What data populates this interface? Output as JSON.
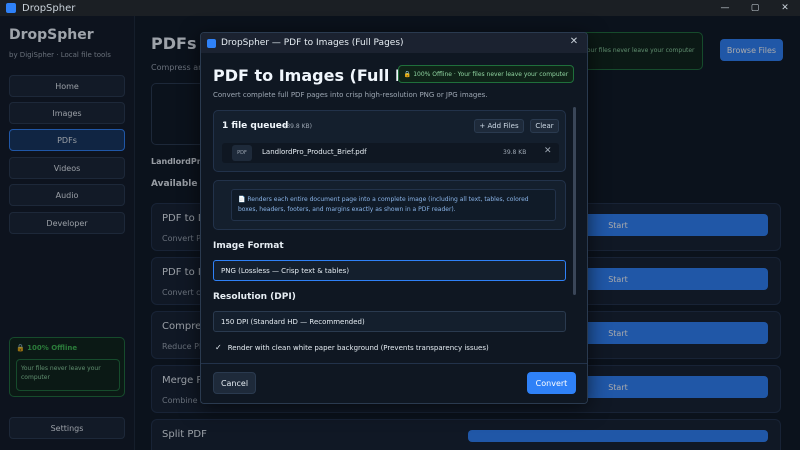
{
  "window": {
    "title": "DropSpher",
    "minimize": "—",
    "maximize": "▢",
    "close": "✕"
  },
  "sidebar": {
    "brand": "DropSpher",
    "brand_sub": "by DigiSpher · Local file tools",
    "items": [
      {
        "label": "Home"
      },
      {
        "label": "Images"
      },
      {
        "label": "PDFs"
      },
      {
        "label": "Videos"
      },
      {
        "label": "Audio"
      },
      {
        "label": "Developer"
      }
    ],
    "offline_title": "🔒 100% Offline",
    "offline_body": "Your files never leave your computer",
    "settings": "Settings"
  },
  "main": {
    "title": "PDFs",
    "subtitle": "Compress and",
    "recent_file": "LandlordPro",
    "section": "Available ac",
    "offline_banner": "Your files never leave your computer",
    "browse": "Browse Files",
    "tools": [
      {
        "name": "PDF to DO",
        "desc": "Convert PDF",
        "start": "Start"
      },
      {
        "name": "PDF to Im",
        "desc": "Convert cor",
        "start": "Start"
      },
      {
        "name": "Compress",
        "desc": "Reduce PDF",
        "start": "Start"
      },
      {
        "name": "Merge PD",
        "desc": "Combine m",
        "start": "Start"
      },
      {
        "name": "Split PDF",
        "desc": "",
        "start": ""
      }
    ]
  },
  "modal": {
    "window_title": "DropSpher — PDF to Images (Full Pages)",
    "close": "✕",
    "title": "PDF to Images (Full Pag",
    "badge": "🔒 100% Offline · Your files never leave your computer",
    "subtitle": "Convert complete full PDF pages into crisp high-resolution PNG or JPG images.",
    "queue": {
      "title": "1 file queued",
      "size": "(39.8 KB)",
      "add": "+ Add Files",
      "clear": "Clear",
      "files": [
        {
          "type": "PDF",
          "name": "LandlordPro_Product_Brief.pdf",
          "size": "39.8 KB",
          "remove": "✕"
        }
      ]
    },
    "info": "📄 Renders each entire document page into a complete image (including all text, tables, colored boxes, headers, footers, and margins exactly as shown in a PDF reader).",
    "format_label": "Image Format",
    "format_value": "PNG (Lossless — Crisp text & tables)",
    "resolution_label": "Resolution (DPI)",
    "resolution_value": "150 DPI (Standard HD — Recommended)",
    "background_check": "✓",
    "background_label": "Render with clean white paper background (Prevents transparency issues)",
    "cancel": "Cancel",
    "convert": "Convert"
  }
}
